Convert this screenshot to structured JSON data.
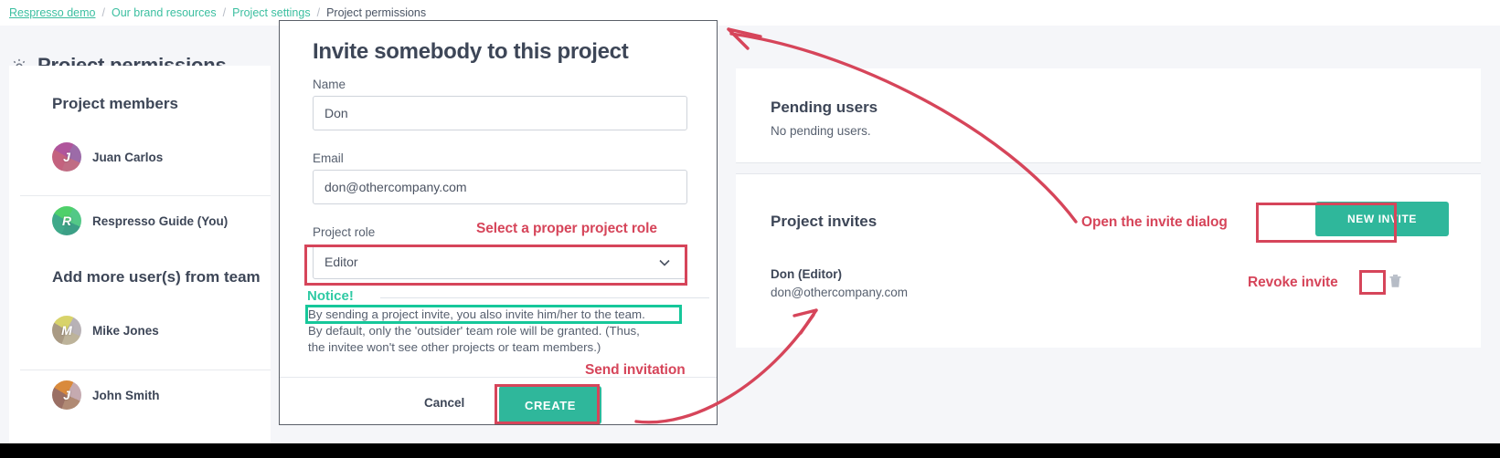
{
  "breadcrumb": {
    "items": [
      "Respresso demo",
      "Our brand resources",
      "Project settings",
      "Project permissions"
    ],
    "separator": "/"
  },
  "page": {
    "title": "Project permissions",
    "gear_icon": "gear-icon"
  },
  "left_panel": {
    "members_heading": "Project members",
    "members": [
      {
        "name": "Juan Carlos",
        "initial": "J",
        "c1": "#c4627e",
        "c2": "#b0559c",
        "c3": "#9c6ba8",
        "c4": "#c06d84"
      },
      {
        "name": "Respresso Guide (You)",
        "initial": "R",
        "c1": "#3fa98a",
        "c2": "#4fd06a",
        "c3": "#53c887",
        "c4": "#3c9f86"
      }
    ],
    "team_heading": "Add more user(s) from team",
    "team": [
      {
        "name": "Mike Jones",
        "initial": "M",
        "c1": "#a99a84",
        "c2": "#d8d36a",
        "c3": "#b8b2b6",
        "c4": "#bdb39a"
      },
      {
        "name": "John Smith",
        "initial": "J",
        "c1": "#9a6f64",
        "c2": "#d98a3c",
        "c3": "#c5aab0",
        "c4": "#b08a74"
      }
    ]
  },
  "pending_users": {
    "title": "Pending users",
    "empty_text": "No pending users."
  },
  "project_invites": {
    "title": "Project invites",
    "new_invite_label": "NEW INVITE",
    "invites": [
      {
        "name_role": "Don (Editor)",
        "email": "don@othercompany.com",
        "delete_icon": "trash-icon"
      }
    ]
  },
  "modal": {
    "title": "Invite somebody to this project",
    "name_label": "Name",
    "name_value": "Don",
    "name_placeholder": "Name",
    "email_label": "Email",
    "email_value": "don@othercompany.com",
    "email_placeholder": "Email",
    "role_label": "Project role",
    "role_value": "Editor",
    "role_options": [
      "Editor"
    ],
    "chevron_icon": "chevron-down-icon",
    "notice_heading": "Notice!",
    "notice_line1": "By sending a project invite, you also invite him/her to the team.",
    "notice_line2": "By default, only the 'outsider' team role will be granted. (Thus,",
    "notice_line3": "the invitee won't see other projects or team members.)",
    "cancel_label": "Cancel",
    "create_label": "CREATE"
  },
  "annotations": {
    "select_role": "Select a proper project role",
    "send_invitation": "Send invitation",
    "open_dialog": "Open the invite dialog",
    "revoke_invite": "Revoke invite"
  },
  "colors": {
    "accent_teal": "#2fb79b",
    "annotation_red": "#d6455a",
    "notice_green": "#16c79a",
    "link_green": "#3bbfa0",
    "page_bg": "#f5f6f9",
    "text_dark": "#3d4657"
  }
}
